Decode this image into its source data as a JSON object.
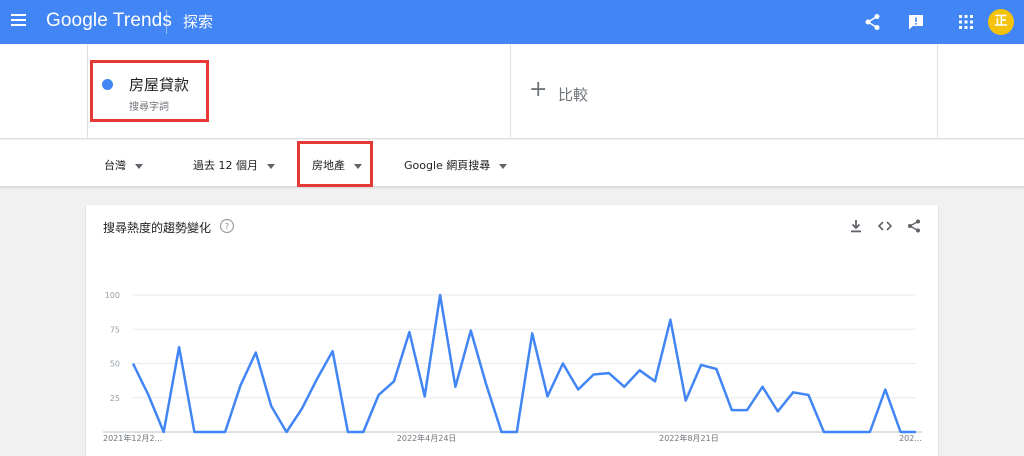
{
  "app": {
    "logo": "Google Trends",
    "section": "探索"
  },
  "term": {
    "name": "房屋貸款",
    "type": "搜尋字詞",
    "color": "#4285f4"
  },
  "compare": {
    "label": "比較"
  },
  "filters": {
    "region": "台灣",
    "time": "過去 12 個月",
    "category": "房地產",
    "property": "Google 網頁搜尋"
  },
  "card": {
    "title": "搜尋熱度的趨勢變化"
  },
  "icons": {
    "menu": "menu-icon",
    "share": "share-icon",
    "feedback": "feedback-icon",
    "apps": "apps-grid-icon",
    "avatar_letter": "正",
    "help": "help-icon",
    "download": "download-icon",
    "embed": "embed-code-icon"
  },
  "colors": {
    "header": "#4285f4",
    "series": "#4285f4",
    "highlight_box": "#e53935",
    "avatar": "#f4c20d"
  },
  "chart_data": {
    "type": "line",
    "ylim": [
      0,
      100
    ],
    "yticks": [
      25,
      50,
      75,
      100
    ],
    "xtick_labels": [
      "2021年12月2...",
      "2022年4月24日",
      "2022年8月21日",
      "202..."
    ],
    "grid": true,
    "series": [
      {
        "values": [
          50,
          27,
          0,
          62,
          0,
          0,
          0,
          34,
          58,
          19,
          0,
          17,
          39,
          59,
          0,
          0,
          27,
          37,
          73,
          26,
          100,
          33,
          74,
          35,
          0,
          0,
          72,
          26,
          50,
          31,
          42,
          43,
          33,
          45,
          37,
          82,
          23,
          49,
          46,
          16,
          16,
          33,
          15,
          29,
          27,
          0,
          0,
          0,
          0,
          31,
          0,
          0
        ]
      }
    ]
  }
}
